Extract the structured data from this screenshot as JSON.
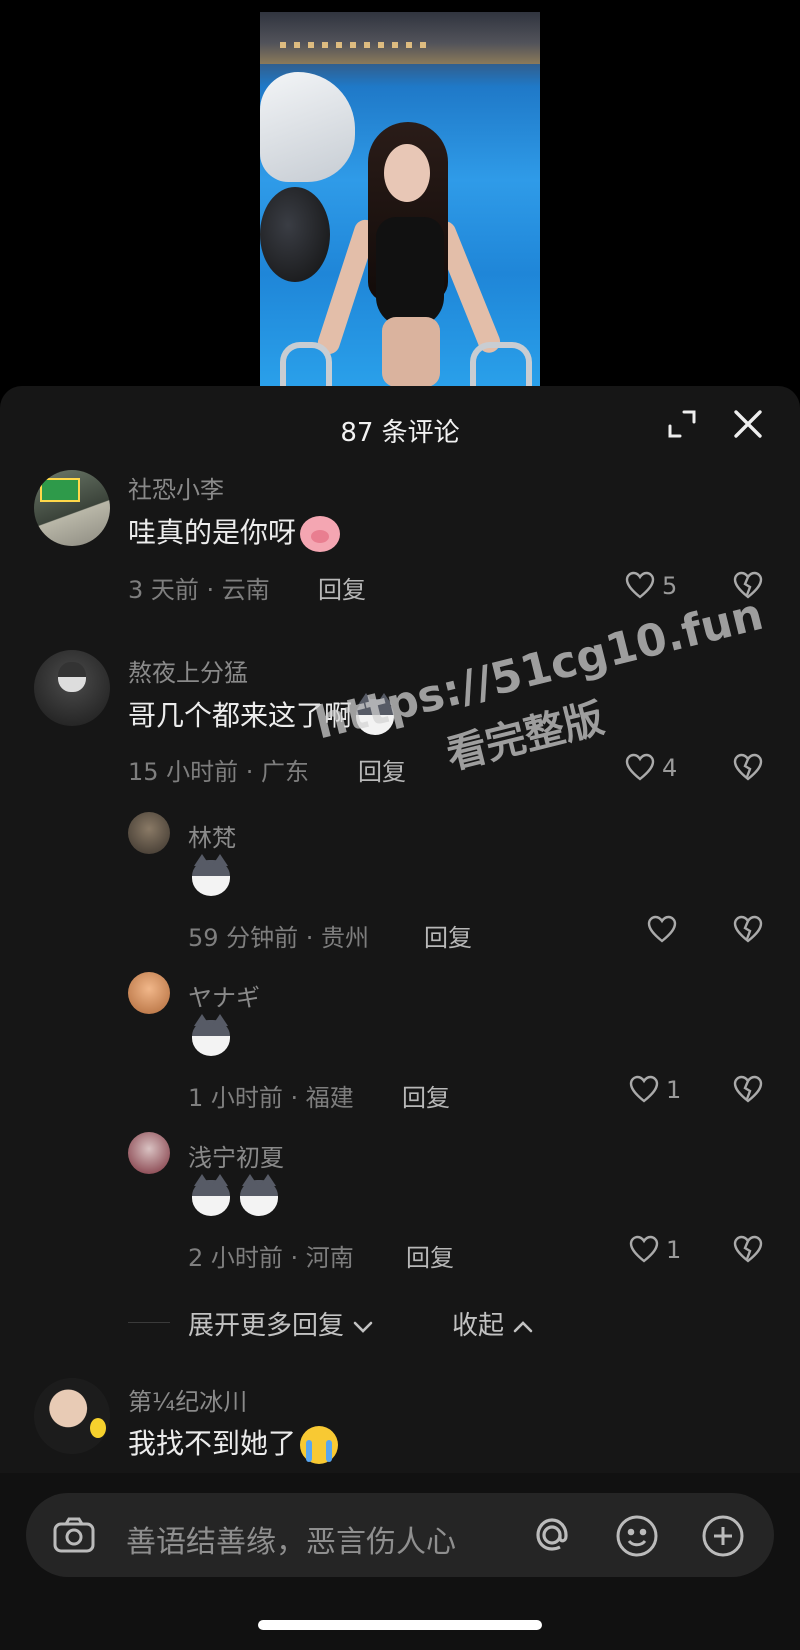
{
  "sheet": {
    "title": "87 条评论"
  },
  "comments": [
    {
      "user": "社恐小李",
      "text": "哇真的是你呀",
      "emoji": "pig",
      "meta": "3 天前 · 云南",
      "reply": "回复",
      "likes": "5"
    },
    {
      "user": "熬夜上分猛",
      "text": "哥几个都来这了啊",
      "emoji": "husky",
      "meta": "15 小时前 · 广东",
      "reply": "回复",
      "likes": "4"
    }
  ],
  "replies": [
    {
      "user": "林梵",
      "emoji_count": 1,
      "meta": "59 分钟前 · 贵州",
      "reply": "回复",
      "likes": ""
    },
    {
      "user": "ヤナギ",
      "emoji_count": 1,
      "meta": "1 小时前 · 福建",
      "reply": "回复",
      "likes": "1"
    },
    {
      "user": "浅宁初夏",
      "emoji_count": 2,
      "meta": "2 小时前 · 河南",
      "reply": "回复",
      "likes": "1"
    }
  ],
  "thread_controls": {
    "more": "展开更多回复",
    "collapse": "收起"
  },
  "last_comment": {
    "user": "第¼纪冰川",
    "text": "我找不到她了",
    "emoji": "cry"
  },
  "watermark": {
    "line1": "https://51cg10.fun",
    "line2": "看完整版"
  },
  "input": {
    "placeholder": "善语结善缘，恶言伤人心"
  },
  "icons": {
    "expand": "expand-icon",
    "close": "close-icon",
    "like": "heart-outline-icon",
    "dislike": "broken-heart-icon",
    "camera": "camera-icon",
    "mention": "at-icon",
    "emoji": "smiley-icon",
    "add": "plus-circle-icon"
  },
  "colors": {
    "sheet_bg": "#161616",
    "text_primary": "#ececec",
    "text_secondary": "#8a8a8a"
  }
}
